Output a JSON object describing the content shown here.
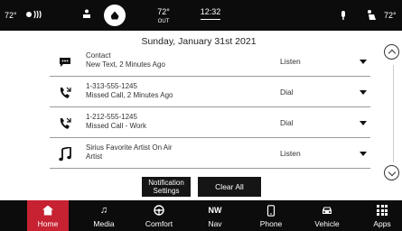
{
  "status_bar": {
    "left_temp": "72°",
    "right_temp": "72°",
    "out_temp": "72°",
    "out_label": "OUT",
    "time": "12:32",
    "icons": [
      "fan-icon",
      "seat-heat-icon",
      "home-circle-icon",
      "mic-icon",
      "passenger-seat-icon"
    ]
  },
  "date": "Sunday, January 31st 2021",
  "notifications": [
    {
      "icon": "message-icon",
      "line1": "Contact",
      "line2": "New Text, 2 Minutes Ago",
      "action": "Listen"
    },
    {
      "icon": "missed-call-icon",
      "line1": "1-313-555-1245",
      "line2": "Missed Call, 2 Minutes Ago",
      "action": "Dial"
    },
    {
      "icon": "missed-call-icon",
      "line1": "1-212-555-1245",
      "line2": "Missed Call - Work",
      "action": "Dial"
    },
    {
      "icon": "music-note-icon",
      "line1": "Sirius Favorite Artist On Air",
      "line2": "Artist",
      "action": "Listen"
    }
  ],
  "buttons": {
    "notification_settings_line1": "Notification",
    "notification_settings_line2": "Settings",
    "clear_all": "Clear All"
  },
  "nav": [
    {
      "label": "Home",
      "icon": "home-icon",
      "active": true
    },
    {
      "label": "Media",
      "icon": "music-icon"
    },
    {
      "label": "Comfort",
      "icon": "steering-wheel-icon"
    },
    {
      "label": "Nav",
      "icon": "compass-icon",
      "heading": "NW"
    },
    {
      "label": "Phone",
      "icon": "phone-icon"
    },
    {
      "label": "Vehicle",
      "icon": "car-icon"
    },
    {
      "label": "Apps",
      "icon": "apps-grid-icon"
    }
  ],
  "colors": {
    "active_tab": "#c62232",
    "bar_background": "#0c0c0c"
  }
}
